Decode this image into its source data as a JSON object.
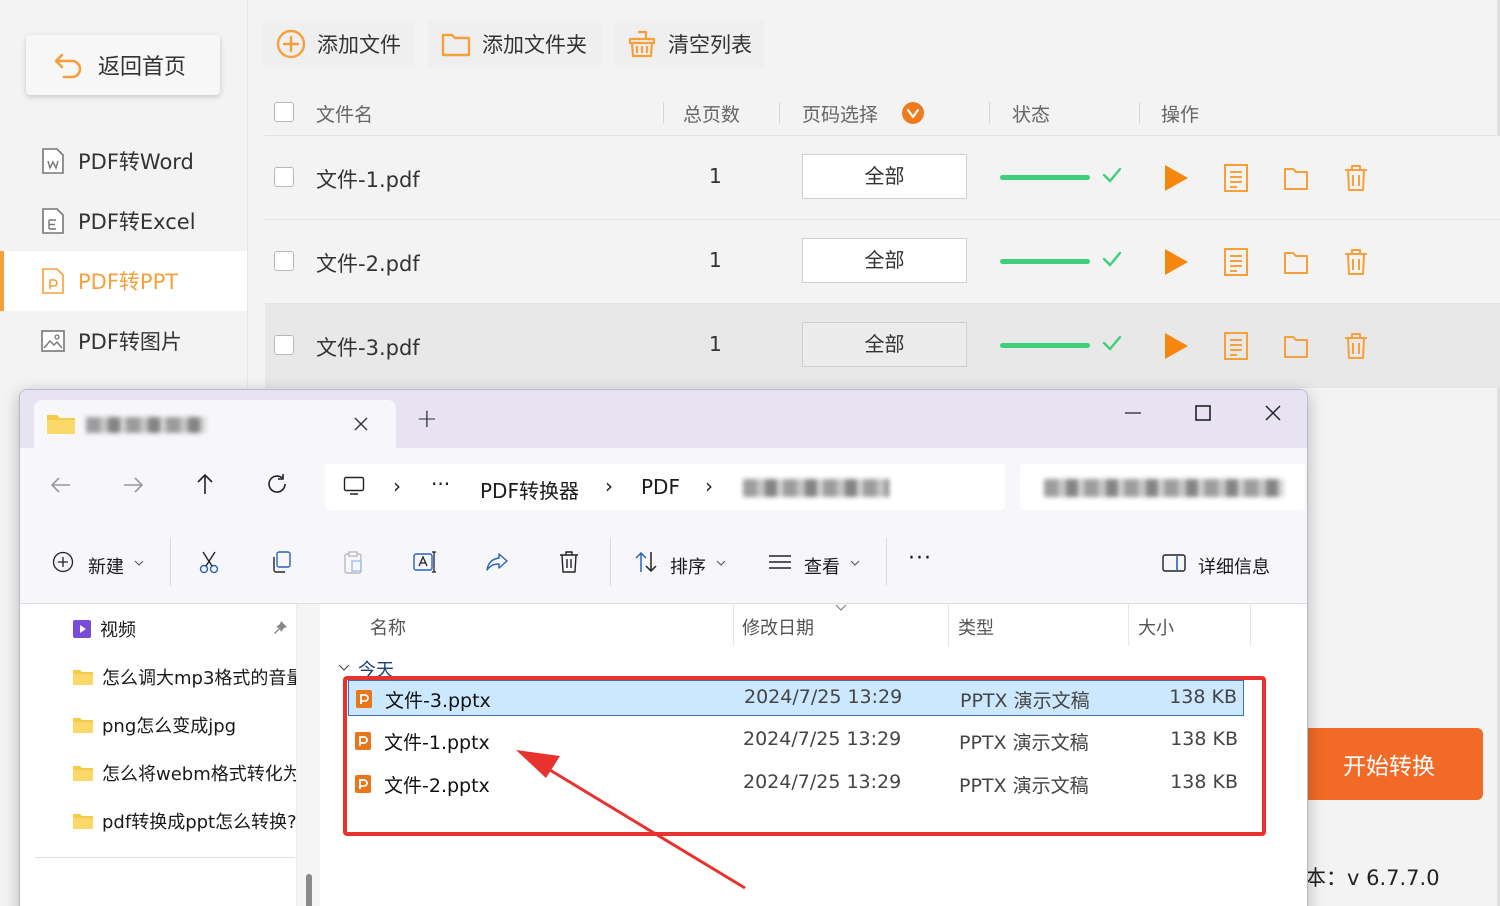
{
  "sidebar": {
    "back_label": "返回首页",
    "items": [
      {
        "label": "PDF转Word",
        "icon": "word-doc-icon"
      },
      {
        "label": "PDF转Excel",
        "icon": "excel-doc-icon"
      },
      {
        "label": "PDF转PPT",
        "icon": "ppt-doc-icon"
      },
      {
        "label": "PDF转图片",
        "icon": "image-icon"
      }
    ]
  },
  "toolbar": {
    "add_file": "添加文件",
    "add_folder": "添加文件夹",
    "clear_list": "清空列表"
  },
  "table": {
    "headers": {
      "name": "文件名",
      "pages": "总页数",
      "page_select": "页码选择",
      "status": "状态",
      "actions": "操作"
    },
    "rows": [
      {
        "name": "文件-1.pdf",
        "pages": "1",
        "page_range": "全部",
        "progress": 1.0
      },
      {
        "name": "文件-2.pdf",
        "pages": "1",
        "page_range": "全部",
        "progress": 1.0
      },
      {
        "name": "文件-3.pdf",
        "pages": "1",
        "page_range": "全部",
        "progress": 1.0
      }
    ]
  },
  "start_button": "开始转换",
  "version": "本：v 6.7.7.0",
  "explorer": {
    "new_tab": "+",
    "breadcrumb": {
      "more": "···",
      "folder1": "PDF转换器",
      "folder2": "PDF",
      "sep": "›"
    },
    "commands": {
      "new": "新建",
      "sort": "排序",
      "view": "查看",
      "more": "···",
      "details": "详细信息"
    },
    "nav_pane": [
      {
        "label": "视频",
        "icon": "video-folder-icon"
      },
      {
        "label": "怎么调大mp3格式的音量",
        "icon": "folder-icon"
      },
      {
        "label": "png怎么变成jpg",
        "icon": "folder-icon"
      },
      {
        "label": "怎么将webm格式转化为",
        "icon": "folder-icon"
      },
      {
        "label": "pdf转换成ppt怎么转换?",
        "icon": "folder-icon"
      }
    ],
    "columns": {
      "name": "名称",
      "modified": "修改日期",
      "type": "类型",
      "size": "大小"
    },
    "group": "今天",
    "files": [
      {
        "name": "文件-3.pptx",
        "modified": "2024/7/25 13:29",
        "type": "PPTX 演示文稿",
        "size": "138 KB"
      },
      {
        "name": "文件-1.pptx",
        "modified": "2024/7/25 13:29",
        "type": "PPTX 演示文稿",
        "size": "138 KB"
      },
      {
        "name": "文件-2.pptx",
        "modified": "2024/7/25 13:29",
        "type": "PPTX 演示文稿",
        "size": "138 KB"
      }
    ]
  },
  "colors": {
    "accent": "#f5a03a",
    "start": "#f26a27",
    "progress": "#3fcf7a",
    "highlight": "#e8322e"
  }
}
